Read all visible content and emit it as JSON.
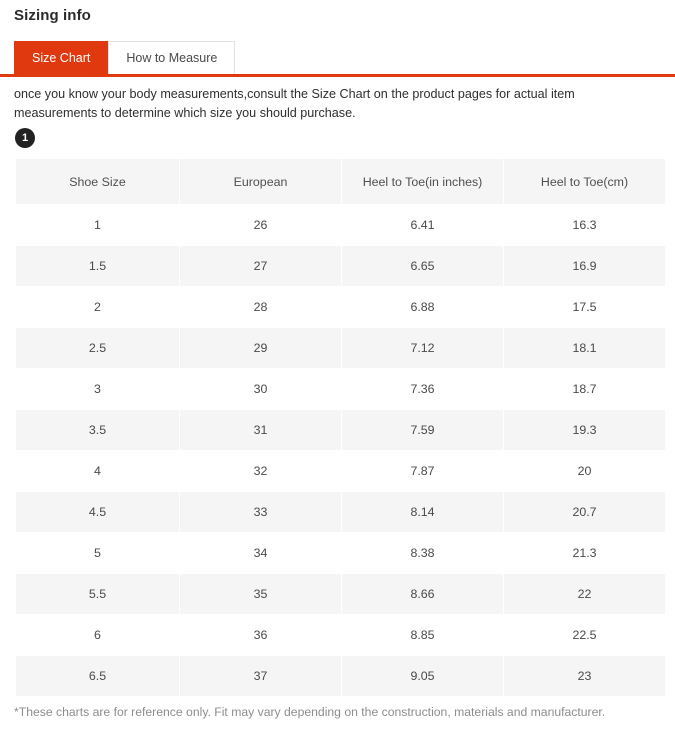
{
  "header": {
    "title": "Sizing info"
  },
  "tabs": [
    {
      "label": "Size Chart",
      "active": true
    },
    {
      "label": "How to Measure",
      "active": false
    }
  ],
  "intro": {
    "text": "once you know your body measurements,consult the Size Chart on the product pages for actual item measurements to determine which size you should purchase."
  },
  "badge": {
    "label": "1"
  },
  "footnote": {
    "text": "*These charts are for reference only. Fit may vary depending on the construction, materials and manufacturer."
  },
  "colors": {
    "accent": "#e0380f",
    "stripe": "#f5f5f5",
    "badge": "#222222",
    "text": "#4a4a4a",
    "muted": "#8d8d8d"
  },
  "chart_data": {
    "type": "table",
    "title": "Size Chart",
    "columns": [
      "Shoe Size",
      "European",
      "Heel to Toe(in inches)",
      "Heel to Toe(cm)"
    ],
    "rows": [
      [
        "1",
        "26",
        "6.41",
        "16.3"
      ],
      [
        "1.5",
        "27",
        "6.65",
        "16.9"
      ],
      [
        "2",
        "28",
        "6.88",
        "17.5"
      ],
      [
        "2.5",
        "29",
        "7.12",
        "18.1"
      ],
      [
        "3",
        "30",
        "7.36",
        "18.7"
      ],
      [
        "3.5",
        "31",
        "7.59",
        "19.3"
      ],
      [
        "4",
        "32",
        "7.87",
        "20"
      ],
      [
        "4.5",
        "33",
        "8.14",
        "20.7"
      ],
      [
        "5",
        "34",
        "8.38",
        "21.3"
      ],
      [
        "5.5",
        "35",
        "8.66",
        "22"
      ],
      [
        "6",
        "36",
        "8.85",
        "22.5"
      ],
      [
        "6.5",
        "37",
        "9.05",
        "23"
      ]
    ]
  }
}
